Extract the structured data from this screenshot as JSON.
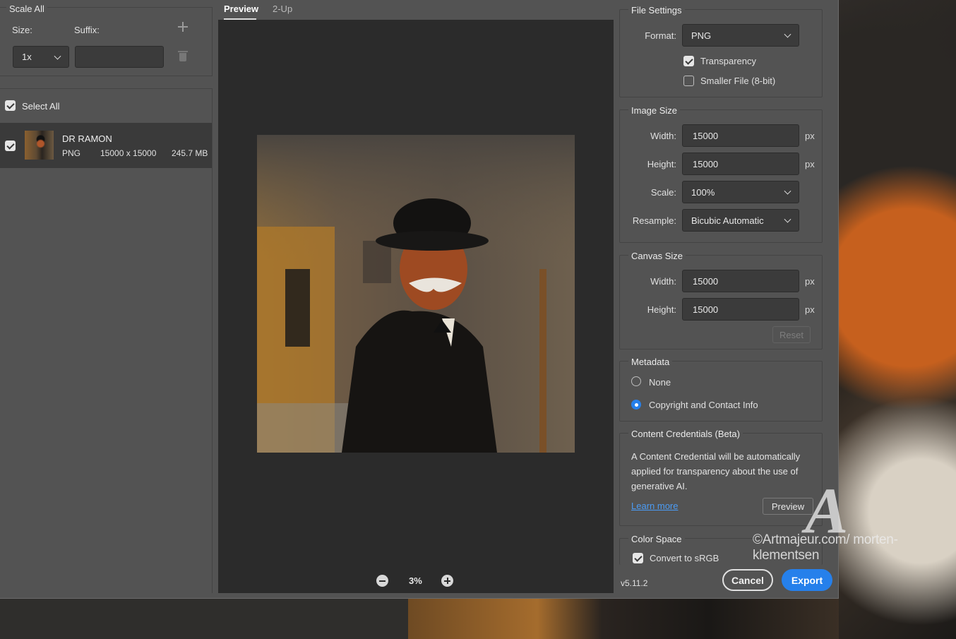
{
  "left": {
    "scale_all": "Scale All",
    "size_label": "Size:",
    "suffix_label": "Suffix:",
    "size_value": "1x",
    "suffix_value": "",
    "select_all": "Select All",
    "asset": {
      "name": "DR RAMON",
      "format": "PNG",
      "dimensions": "15000 x 15000",
      "filesize": "245.7 MB"
    }
  },
  "preview": {
    "tabs": [
      "Preview",
      "2-Up"
    ],
    "zoom": "3%"
  },
  "file_settings": {
    "title": "File Settings",
    "format_label": "Format:",
    "format_value": "PNG",
    "transparency": "Transparency",
    "smaller_file": "Smaller File (8-bit)"
  },
  "image_size": {
    "title": "Image Size",
    "width_label": "Width:",
    "width_value": "15000",
    "height_label": "Height:",
    "height_value": "15000",
    "scale_label": "Scale:",
    "scale_value": "100%",
    "resample_label": "Resample:",
    "resample_value": "Bicubic Automatic",
    "unit": "px"
  },
  "canvas_size": {
    "title": "Canvas Size",
    "width_label": "Width:",
    "width_value": "15000",
    "height_label": "Height:",
    "height_value": "15000",
    "unit": "px",
    "reset": "Reset"
  },
  "metadata": {
    "title": "Metadata",
    "none": "None",
    "copyright": "Copyright and Contact Info"
  },
  "content_credentials": {
    "title": "Content Credentials (Beta)",
    "description": "A Content Credential will be automatically applied for transparency about the use of generative AI.",
    "learn_more": "Learn more",
    "preview_button": "Preview"
  },
  "color_space": {
    "title": "Color Space",
    "convert": "Convert to sRGB"
  },
  "footer": {
    "version": "v5.11.2",
    "cancel": "Cancel",
    "export": "Export"
  },
  "watermark": {
    "text": "©Artmajeur.com/ morten-klementsen",
    "logo": "A"
  },
  "colors": {
    "accent": "#2680eb",
    "panel": "#535353",
    "preview_bg": "#2b2b2b"
  }
}
